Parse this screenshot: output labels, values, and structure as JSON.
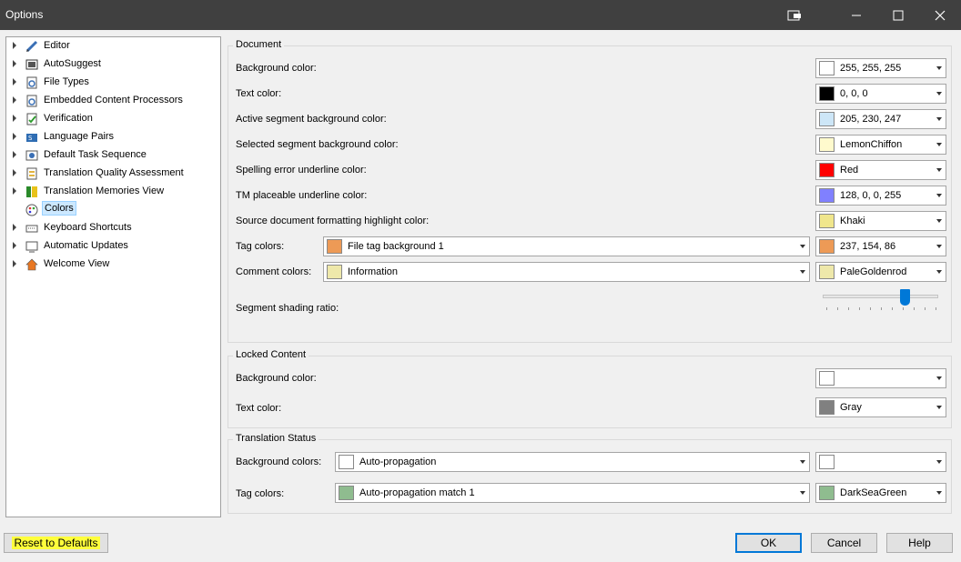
{
  "window": {
    "title": "Options"
  },
  "tree": {
    "items": [
      {
        "label": "Editor",
        "icon": "pencil-icon",
        "selected": false
      },
      {
        "label": "AutoSuggest",
        "icon": "autosuggest-icon",
        "selected": false
      },
      {
        "label": "File Types",
        "icon": "file-types-icon",
        "selected": false
      },
      {
        "label": "Embedded Content Processors",
        "icon": "embedded-content-icon",
        "selected": false
      },
      {
        "label": "Verification",
        "icon": "verification-icon",
        "selected": false
      },
      {
        "label": "Language Pairs",
        "icon": "language-pairs-icon",
        "selected": false
      },
      {
        "label": "Default Task Sequence",
        "icon": "task-sequence-icon",
        "selected": false
      },
      {
        "label": "Translation Quality Assessment",
        "icon": "quality-assessment-icon",
        "selected": false
      },
      {
        "label": "Translation Memories View",
        "icon": "tm-view-icon",
        "selected": false
      },
      {
        "label": "Colors",
        "icon": "palette-icon",
        "selected": true
      },
      {
        "label": "Keyboard Shortcuts",
        "icon": "keyboard-icon",
        "selected": false
      },
      {
        "label": "Automatic Updates",
        "icon": "updates-icon",
        "selected": false
      },
      {
        "label": "Welcome View",
        "icon": "home-icon",
        "selected": false
      }
    ]
  },
  "document": {
    "title": "Document",
    "rows": {
      "background": {
        "label": "Background color:",
        "value": "255, 255, 255",
        "swatch": "#ffffff"
      },
      "text": {
        "label": "Text color:",
        "value": "0, 0, 0",
        "swatch": "#000000"
      },
      "active_segment": {
        "label": "Active segment background color:",
        "value": "205, 230, 247",
        "swatch": "#cde6f7"
      },
      "selected_segment": {
        "label": "Selected segment background color:",
        "value": "LemonChiffon",
        "swatch": "#fffacd"
      },
      "spelling": {
        "label": "Spelling error underline color:",
        "value": "Red",
        "swatch": "#ff0000"
      },
      "tm_placeable": {
        "label": "TM placeable underline color:",
        "value": "128, 0, 0, 255",
        "swatch": "#8080ff"
      },
      "source_formatting": {
        "label": "Source document formatting highlight color:",
        "value": "Khaki",
        "swatch": "#f0e68c"
      },
      "tag": {
        "label": "Tag colors:",
        "type_value": "File tag background 1",
        "type_swatch": "#ed9a56",
        "value": "237, 154, 86",
        "swatch": "#ed9a56"
      },
      "comment": {
        "label": "Comment colors:",
        "type_value": "Information",
        "type_swatch": "#eee8aa",
        "value": "PaleGoldenrod",
        "swatch": "#eee8aa"
      }
    },
    "shading": {
      "label": "Segment shading ratio:",
      "level": 0.73
    }
  },
  "locked": {
    "title": "Locked Content",
    "background": {
      "label": "Background color:",
      "value": "",
      "swatch": "#ffffff"
    },
    "text": {
      "label": "Text color:",
      "value": "Gray",
      "swatch": "#808080"
    }
  },
  "status": {
    "title": "Translation Status",
    "background": {
      "label": "Background colors:",
      "type_value": "Auto-propagation",
      "type_swatch": "#ffffff",
      "value": "",
      "swatch": "#ffffff"
    },
    "tag": {
      "label": "Tag colors:",
      "type_value": "Auto-propagation match 1",
      "type_swatch": "#8fbc8f",
      "value": "DarkSeaGreen",
      "swatch": "#8fbc8f"
    }
  },
  "buttons": {
    "reset": "Reset to Defaults",
    "ok": "OK",
    "cancel": "Cancel",
    "help": "Help"
  }
}
